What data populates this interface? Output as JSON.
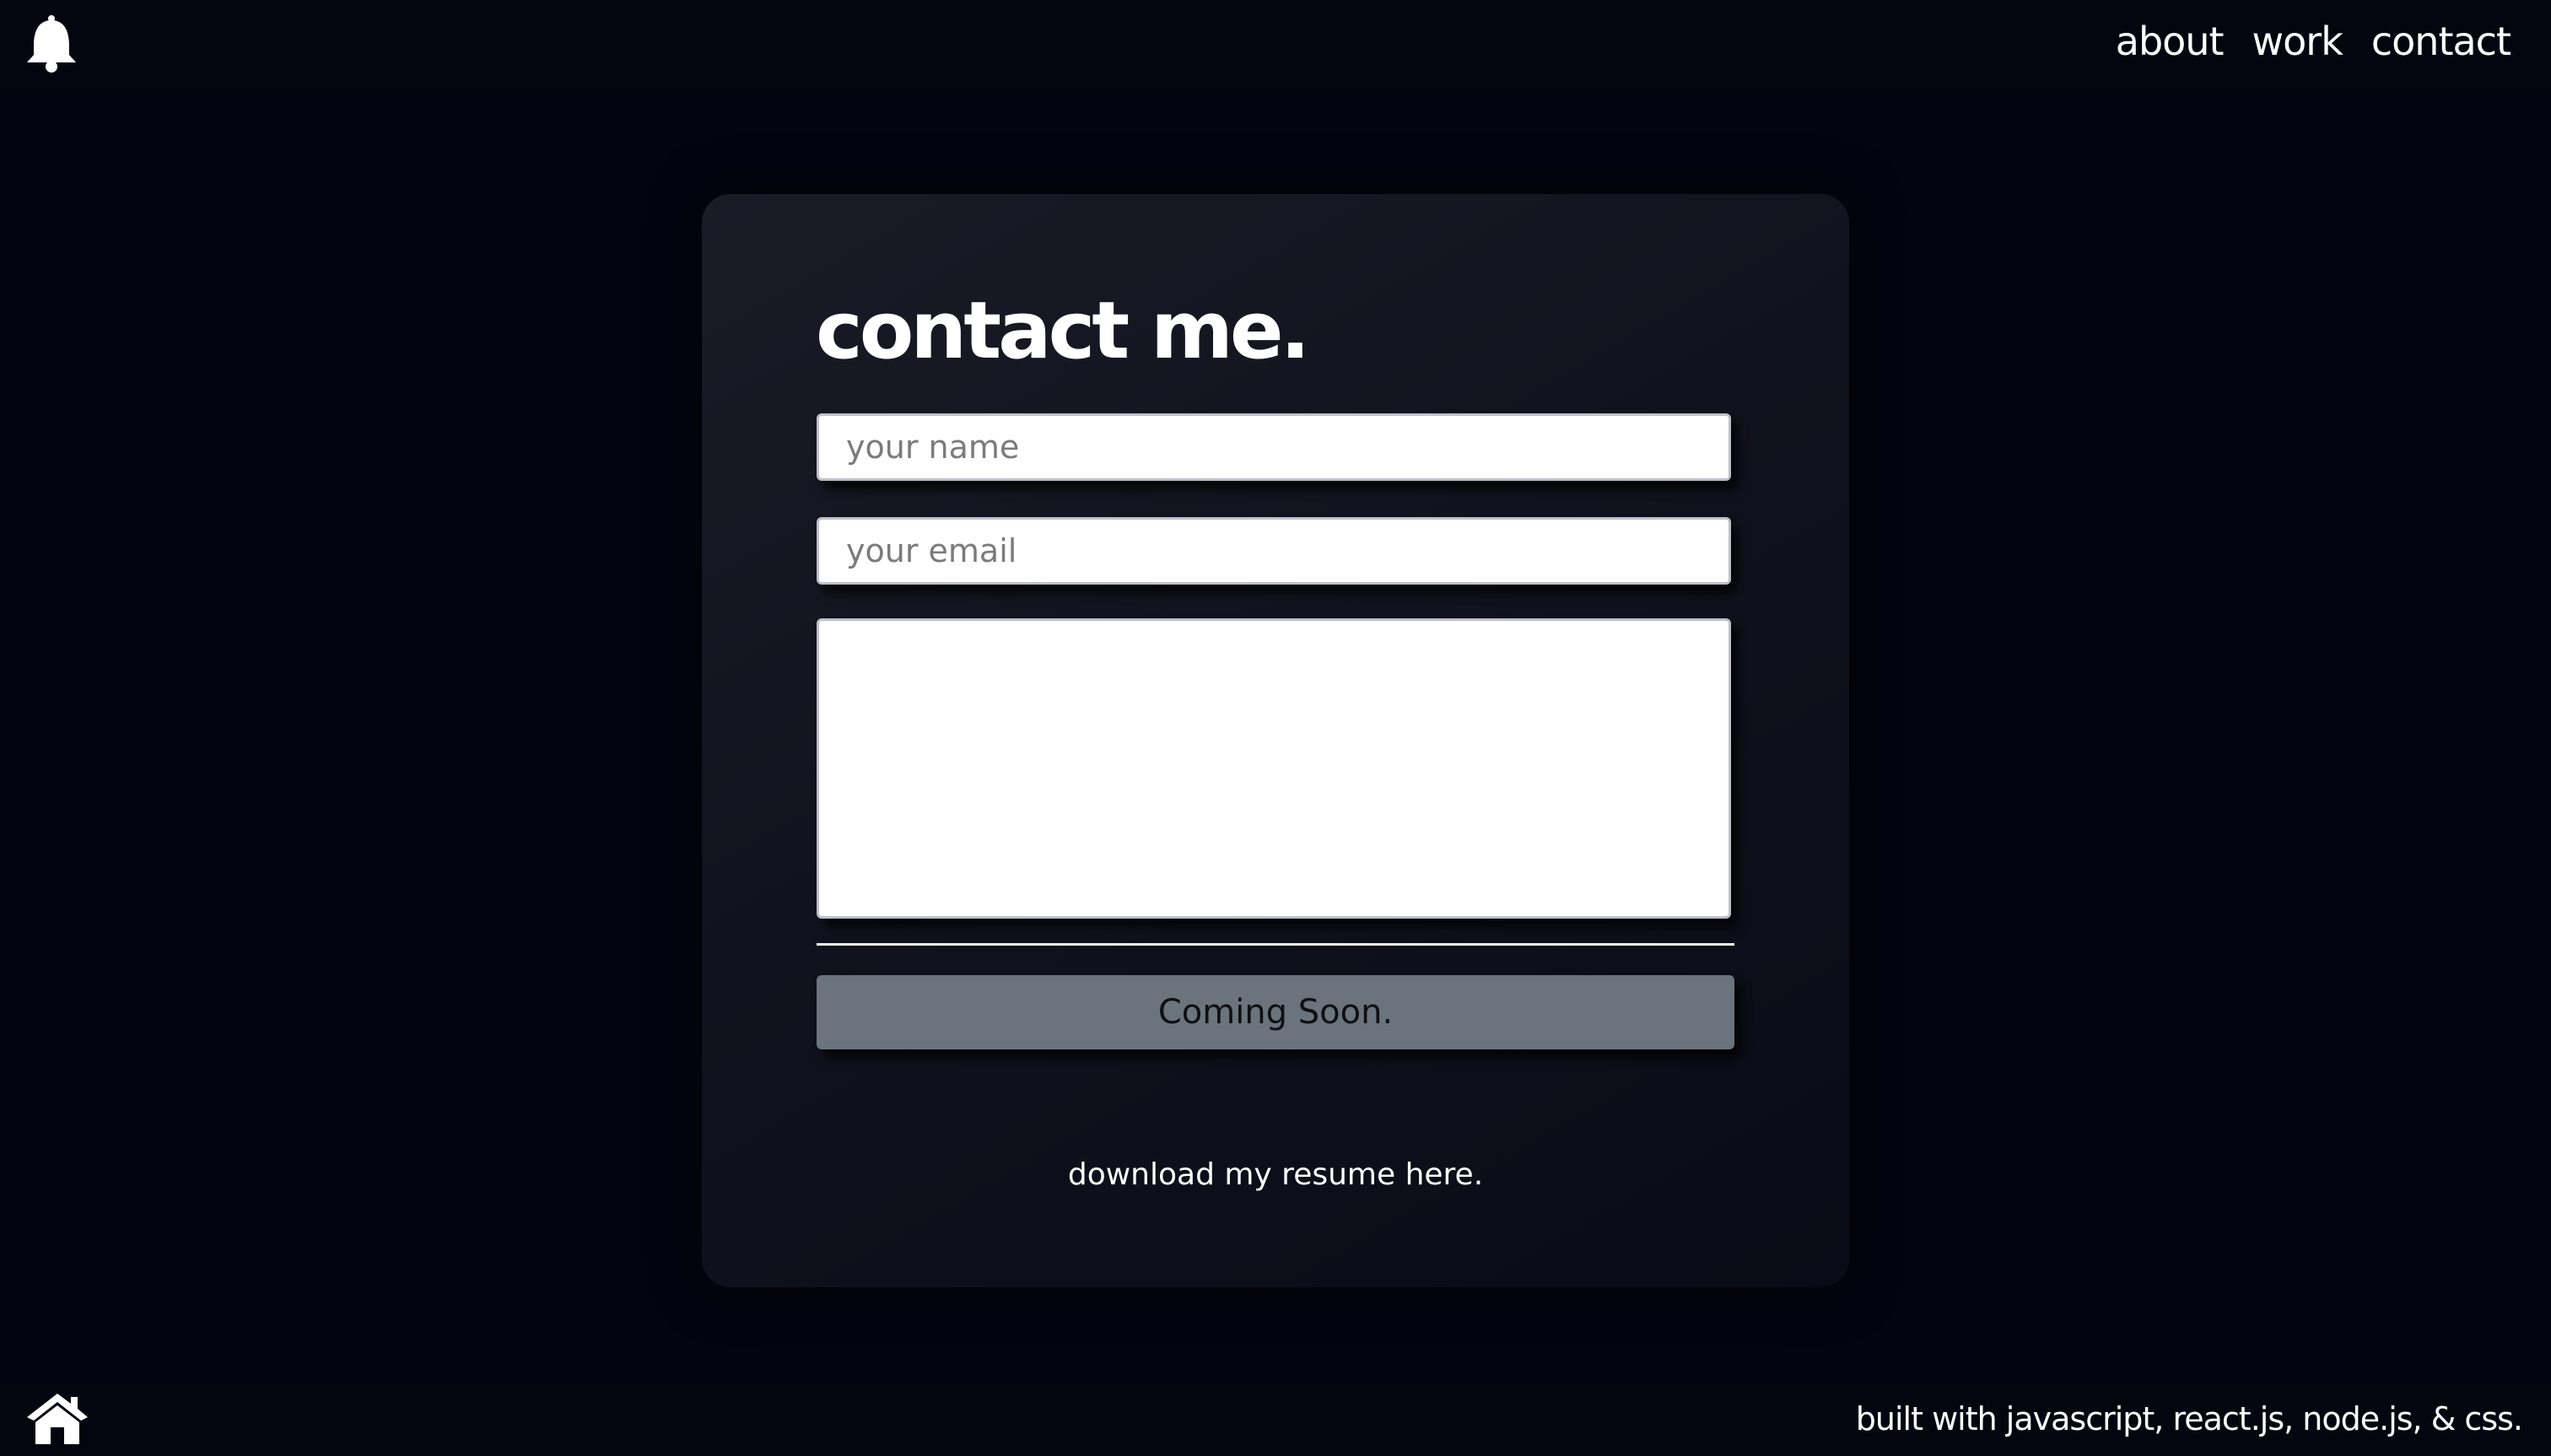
{
  "header": {
    "bell_icon": "bell-icon",
    "nav": {
      "about": "about",
      "work": "work",
      "contact": "contact"
    }
  },
  "contact_card": {
    "title": "contact me.",
    "name_placeholder": "your name",
    "email_placeholder": "your email",
    "message_value": "",
    "submit_label": "Coming Soon.",
    "resume_link": "download my resume here."
  },
  "footer": {
    "home_icon": "home-icon",
    "credits": "built with javascript, react.js, node.js, & css."
  },
  "colors": {
    "background": "#03040f",
    "card": "#14151f",
    "button": "#6b747d",
    "text": "#ffffff"
  }
}
